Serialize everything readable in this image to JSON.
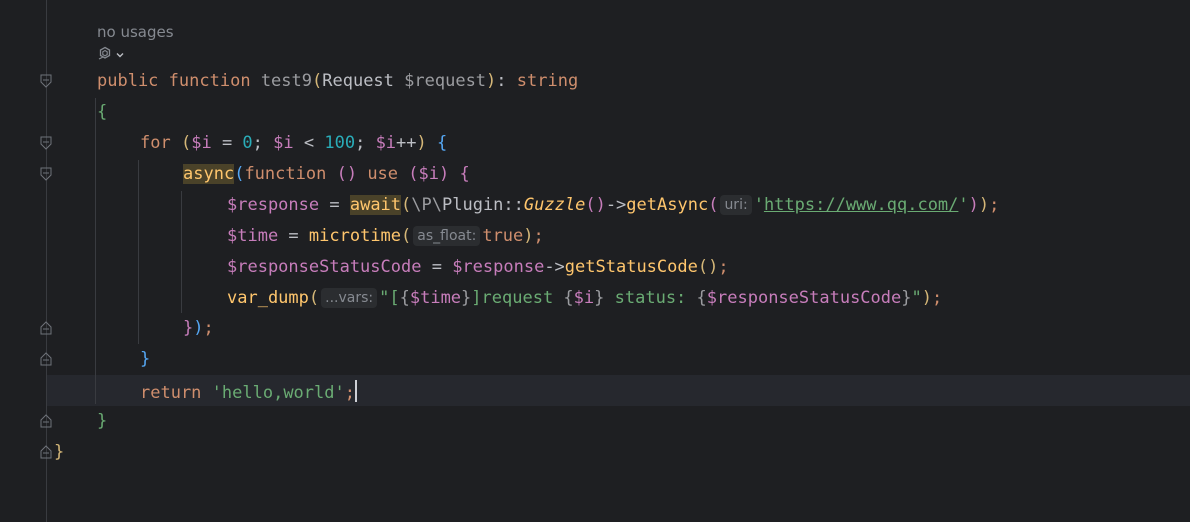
{
  "editor": {
    "usages_label": "no usages",
    "ai_icon": "ai-assistant-icon",
    "ai_chevron": "chevron-down-icon",
    "lines": {
      "sig": {
        "kw_public": "public",
        "kw_function": "function",
        "name": "test9",
        "paren_open": "(",
        "param_type": "Request",
        "param_var": "$request",
        "paren_close": ")",
        "colon": ":",
        "ret_type": "string"
      },
      "brace_open_fn": "{",
      "for_line": {
        "kw": "for",
        "paren_open": "(",
        "v1": "$i",
        "eq": " = ",
        "zero": "0",
        "semi1": "; ",
        "v2": "$i",
        "lt": " < ",
        "hundred": "100",
        "semi2": "; ",
        "v3": "$i",
        "inc": "++",
        "paren_close": ")",
        "brace": "{"
      },
      "async_line": {
        "async": "async",
        "paren_open": "(",
        "kw_function": "function",
        "empty_parens": "()",
        "kw_use": "use",
        "use_open": "(",
        "use_var": "$i",
        "use_close": ")",
        "brace": "{"
      },
      "response_line": {
        "var": "$response",
        "eq": " = ",
        "await": "await",
        "paren_open": "(",
        "ns": "\\P\\",
        "cls": "Plugin",
        "dcolon": "::",
        "guzzle": "Guzzle",
        "guzzle_parens": "()",
        "arrow": "->",
        "method": "getAsync",
        "m_open": "(",
        "hint": "uri:",
        "str_q1": "'",
        "url": "https://www.qq.com/",
        "str_q2": "'",
        "m_close": ")",
        "a_close": ")",
        "semi": ";"
      },
      "time_line": {
        "var": "$time",
        "eq": " = ",
        "fn": "microtime",
        "open": "(",
        "hint": "as_float:",
        "val": "true",
        "close": ")",
        "semi": ";"
      },
      "status_line": {
        "var": "$responseStatusCode",
        "eq": " = ",
        "var2": "$response",
        "arrow": "->",
        "method": "getStatusCode",
        "parens": "()",
        "semi": ";"
      },
      "dump_line": {
        "fn": "var_dump",
        "open": "(",
        "hint": "...vars:",
        "s1": "\"[",
        "i1_open": "{",
        "i1_var": "$time",
        "i1_close": "}",
        "s2": "]request ",
        "i2_open": "{",
        "i2_var": "$i",
        "i2_close": "}",
        "s3": " status: ",
        "i3_open": "{",
        "i3_var": "$responseStatusCode",
        "i3_close": "}",
        "s4": "\"",
        "close": ")",
        "semi": ";"
      },
      "async_close": {
        "brace": "}",
        "paren": ")",
        "semi": ";"
      },
      "for_close": "}",
      "return_line": {
        "kw": "return",
        "str": "'hello,world'",
        "semi": ";"
      },
      "fn_close": "}",
      "class_close": "}"
    }
  }
}
